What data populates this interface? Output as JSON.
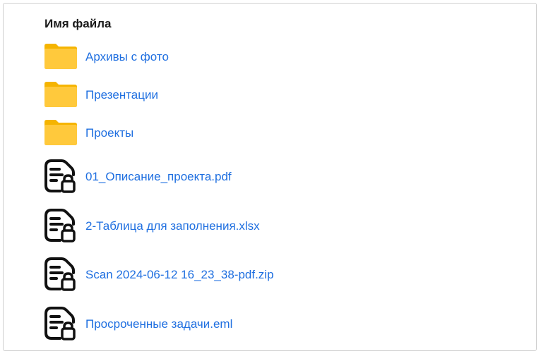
{
  "header": {
    "title": "Имя файла"
  },
  "colors": {
    "folder": "#FFC93C",
    "folder_tab": "#F5B400",
    "link": "#1f6fe0",
    "icon_dark": "#111111"
  },
  "files": [
    {
      "name": "Архивы с фото",
      "type": "folder",
      "icon": "folder-icon"
    },
    {
      "name": "Презентации",
      "type": "folder",
      "icon": "folder-icon"
    },
    {
      "name": "Проекты",
      "type": "folder",
      "icon": "folder-icon"
    },
    {
      "name": "01_Описание_проекта.pdf",
      "type": "locked-file",
      "icon": "locked-document-icon"
    },
    {
      "name": "2-Таблица для заполнения.xlsx",
      "type": "locked-file",
      "icon": "locked-document-icon"
    },
    {
      "name": "Scan 2024-06-12 16_23_38-pdf.zip",
      "type": "locked-file",
      "icon": "locked-document-icon"
    },
    {
      "name": "Просроченные задачи.eml",
      "type": "locked-file",
      "icon": "locked-document-icon"
    }
  ]
}
